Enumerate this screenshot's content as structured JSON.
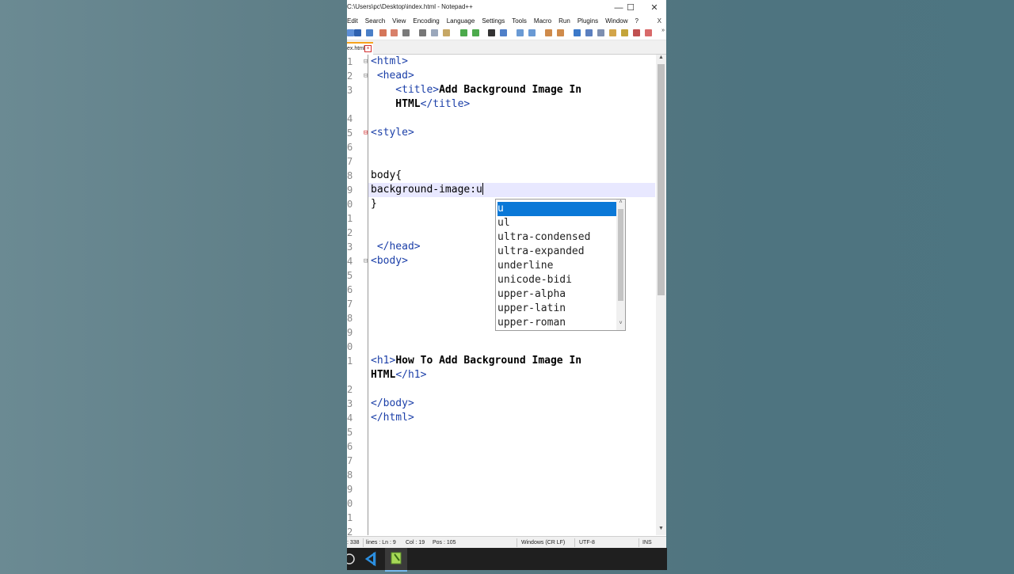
{
  "window": {
    "title": "C:\\Users\\pc\\Desktop\\index.html - Notepad++"
  },
  "menu": {
    "items": [
      "Edit",
      "Search",
      "View",
      "Encoding",
      "Language",
      "Settings",
      "Tools",
      "Macro",
      "Run",
      "Plugins",
      "Window",
      "?"
    ],
    "close": "X"
  },
  "tab": {
    "label": "ex.html"
  },
  "editor": {
    "line_numbers": [
      "1",
      "2",
      "3",
      "",
      "4",
      "5",
      "6",
      "7",
      "8",
      "9",
      "0",
      "1",
      "2",
      "3",
      "4",
      "5",
      "6",
      "7",
      "8",
      "9",
      "0",
      "1",
      "",
      "2",
      "3",
      "4",
      "5",
      "6",
      "7",
      "8",
      "9",
      "0",
      "1",
      "2"
    ],
    "lines": [
      {
        "n": "1",
        "segs": [
          {
            "t": "<html>",
            "c": "tag"
          }
        ]
      },
      {
        "n": "2",
        "segs": [
          {
            "t": " <head>",
            "c": "tag"
          }
        ]
      },
      {
        "n": "3",
        "segs": [
          {
            "t": "    <title>",
            "c": "tag"
          },
          {
            "t": "Add Background Image In",
            "c": "bold"
          }
        ]
      },
      {
        "n": "",
        "segs": [
          {
            "t": "    HTML",
            "c": "bold"
          },
          {
            "t": "</title>",
            "c": "tag"
          }
        ]
      },
      {
        "n": "4",
        "segs": []
      },
      {
        "n": "5",
        "segs": [
          {
            "t": "<style>",
            "c": "tag"
          }
        ]
      },
      {
        "n": "6",
        "segs": []
      },
      {
        "n": "7",
        "segs": []
      },
      {
        "n": "8",
        "segs": [
          {
            "t": "body{",
            "c": "txt"
          }
        ]
      },
      {
        "n": "9",
        "segs": [
          {
            "t": "background-image:u",
            "c": "txt"
          }
        ]
      },
      {
        "n": "0",
        "segs": [
          {
            "t": "}",
            "c": "txt"
          }
        ]
      },
      {
        "n": "1",
        "segs": []
      },
      {
        "n": "2",
        "segs": []
      },
      {
        "n": "3",
        "segs": [
          {
            "t": " </head>",
            "c": "tag"
          }
        ]
      },
      {
        "n": "4",
        "segs": [
          {
            "t": "<body>",
            "c": "tag"
          }
        ]
      },
      {
        "n": "5",
        "segs": []
      },
      {
        "n": "6",
        "segs": []
      },
      {
        "n": "7",
        "segs": []
      },
      {
        "n": "8",
        "segs": []
      },
      {
        "n": "9",
        "segs": []
      },
      {
        "n": "0",
        "segs": []
      },
      {
        "n": "1",
        "segs": [
          {
            "t": "<h1>",
            "c": "tag"
          },
          {
            "t": "How To Add Background Image In",
            "c": "bold"
          }
        ]
      },
      {
        "n": "",
        "segs": [
          {
            "t": "HTML",
            "c": "bold"
          },
          {
            "t": "</h1>",
            "c": "tag"
          }
        ]
      },
      {
        "n": "2",
        "segs": []
      },
      {
        "n": "3",
        "segs": [
          {
            "t": "</body>",
            "c": "tag"
          }
        ]
      },
      {
        "n": "4",
        "segs": [
          {
            "t": "</html>",
            "c": "tag"
          }
        ]
      },
      {
        "n": "5",
        "segs": []
      },
      {
        "n": "6",
        "segs": []
      },
      {
        "n": "7",
        "segs": []
      },
      {
        "n": "8",
        "segs": []
      },
      {
        "n": "9",
        "segs": []
      },
      {
        "n": "0",
        "segs": []
      },
      {
        "n": "1",
        "segs": []
      },
      {
        "n": "2",
        "segs": []
      }
    ]
  },
  "autocomplete": {
    "items": [
      "u",
      "ul",
      "ultra-condensed",
      "ultra-expanded",
      "underline",
      "unicode-bidi",
      "upper-alpha",
      "upper-latin",
      "upper-roman"
    ],
    "selected": 0
  },
  "status": {
    "length": ": 338",
    "lines": "lines : Ln : 9",
    "col": "Col : 19",
    "pos": "Pos : 105",
    "eol": "Windows (CR LF)",
    "encoding": "UTF-8",
    "mode": "INS"
  },
  "colors": {
    "tag": "#1b3fa8",
    "selection": "#0a78d7",
    "current_line": "#e8e8ff",
    "tab_accent": "#f7a31c"
  }
}
